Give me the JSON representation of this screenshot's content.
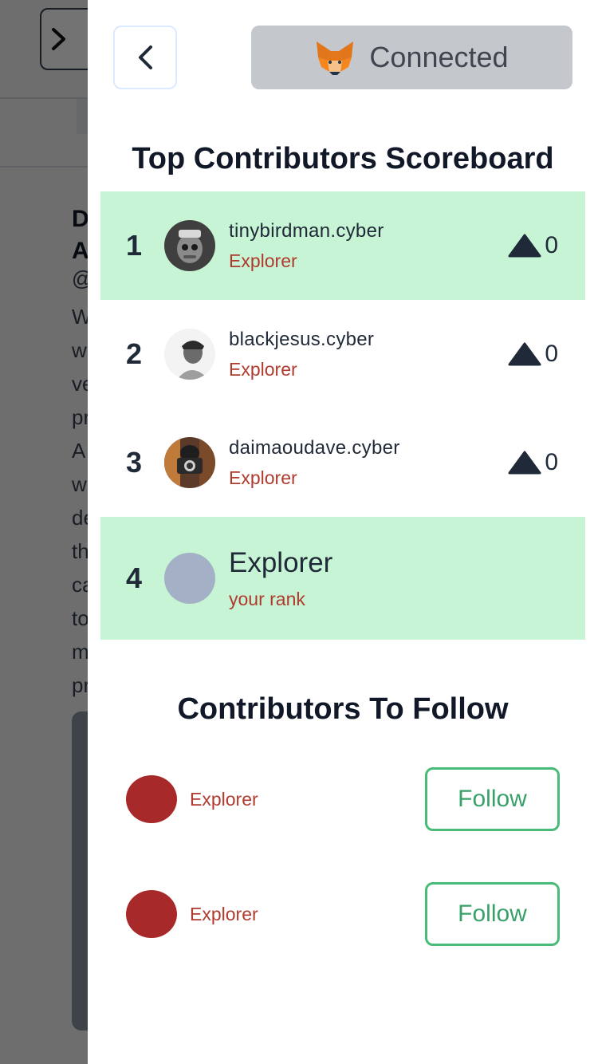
{
  "background": {
    "title_lines": [
      "D",
      "A"
    ],
    "handle": "@",
    "body_lines": [
      "W",
      "w",
      "ve",
      "pr",
      "A",
      "w",
      "de",
      "th",
      "ca",
      "to",
      "m",
      "pr"
    ]
  },
  "header": {
    "connected_label": "Connected",
    "wallet_icon": "metamask-fox-icon"
  },
  "scoreboard": {
    "title": "Top Contributors Scoreboard",
    "entries": [
      {
        "rank": "1",
        "name": "tinybirdman.cyber",
        "role": "Explorer",
        "score": "0"
      },
      {
        "rank": "2",
        "name": "blackjesus.cyber",
        "role": "Explorer",
        "score": "0"
      },
      {
        "rank": "3",
        "name": "daimaoudave.cyber",
        "role": "Explorer",
        "score": "0"
      }
    ],
    "my_rank": {
      "rank": "4",
      "name": "Explorer",
      "subtitle": "your rank"
    }
  },
  "follow_section": {
    "title": "Contributors To Follow",
    "items": [
      {
        "name": "Explorer",
        "button_label": "Follow"
      },
      {
        "name": "Explorer",
        "button_label": "Follow"
      }
    ]
  },
  "colors": {
    "highlight_row": "#c6f4d4",
    "role_text": "#b03a2e",
    "follow_green": "#38a169",
    "connected_bg": "#c4c7cc"
  }
}
